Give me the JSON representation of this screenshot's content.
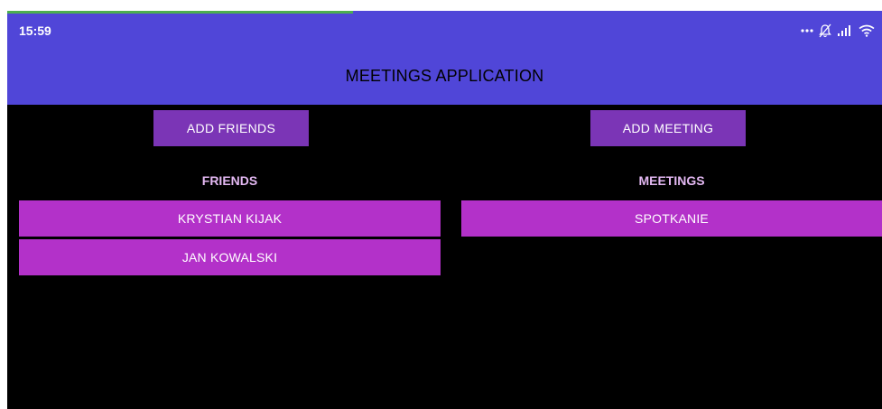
{
  "status_bar": {
    "time": "15:59",
    "icons": [
      "more-dots-icon",
      "mute-bell-icon",
      "signal-icon",
      "wifi-icon"
    ]
  },
  "app_bar": {
    "title": "MEETINGS APPLICATION"
  },
  "buttons": {
    "add_friends": "ADD FRIENDS",
    "add_meeting": "ADD MEETING"
  },
  "friends": {
    "heading": "FRIENDS",
    "items": [
      "KRYSTIAN KIJAK",
      "JAN KOWALSKI"
    ]
  },
  "meetings": {
    "heading": "MEETINGS",
    "items": [
      "SPOTKANIE"
    ]
  },
  "colors": {
    "app_bar": "#5046d8",
    "button": "#7b35b6",
    "list_item": "#b331c9",
    "heading_text": "#e3b8f2",
    "background": "#000000"
  }
}
